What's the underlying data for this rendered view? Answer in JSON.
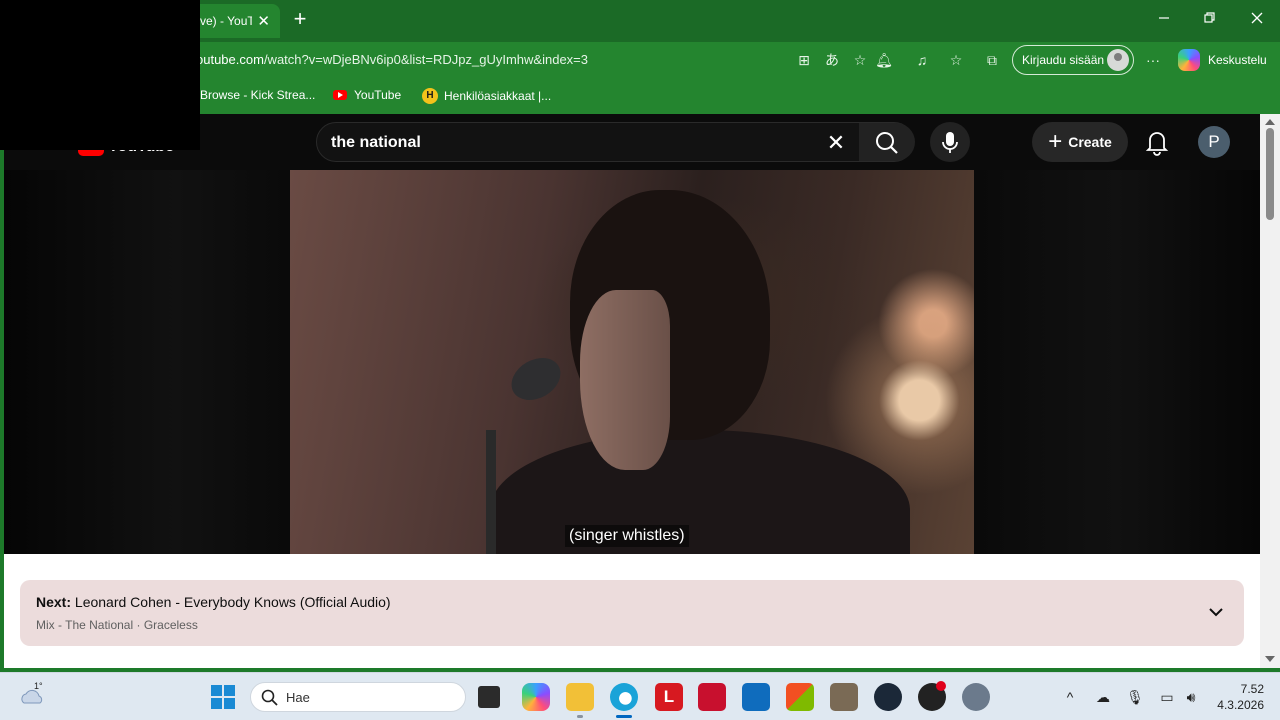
{
  "browser": {
    "tab_title": "ve) - YouTube",
    "url_host": "outube.com",
    "url_path": "/watch?v=wDjeBNv6ip0&list=RDJpz_gUyImhw&index=3",
    "signin_label": "Kirjaudu sisään",
    "copilot_label": "Keskustelu",
    "bookmarks": [
      {
        "label": "Browse - Kick Strea...",
        "icon": "kick-icon"
      },
      {
        "label": "YouTube",
        "icon": "youtube-icon"
      },
      {
        "label": "Henkilöasiakkaat |...",
        "icon": "bank-icon"
      }
    ]
  },
  "youtube": {
    "logo_text": "YouTube",
    "search_value": "the national",
    "create_label": "Create",
    "avatar_letter": "P",
    "caption": "(singer whistles)",
    "next": {
      "prefix": "Next:",
      "title": "Leonard Cohen - Everybody Knows (Official Audio)",
      "subtitle": "Mix - The National · Graceless"
    }
  },
  "taskbar": {
    "weather_temp": "1°",
    "search_placeholder": "Hae",
    "time": "7.52",
    "date": "4.3.2026"
  },
  "colors": {
    "browser_theme": "#24852f",
    "youtube_red": "#ff0000",
    "next_panel_bg": "#ecdcdc",
    "taskbar_bg": "#dfe8f1"
  }
}
